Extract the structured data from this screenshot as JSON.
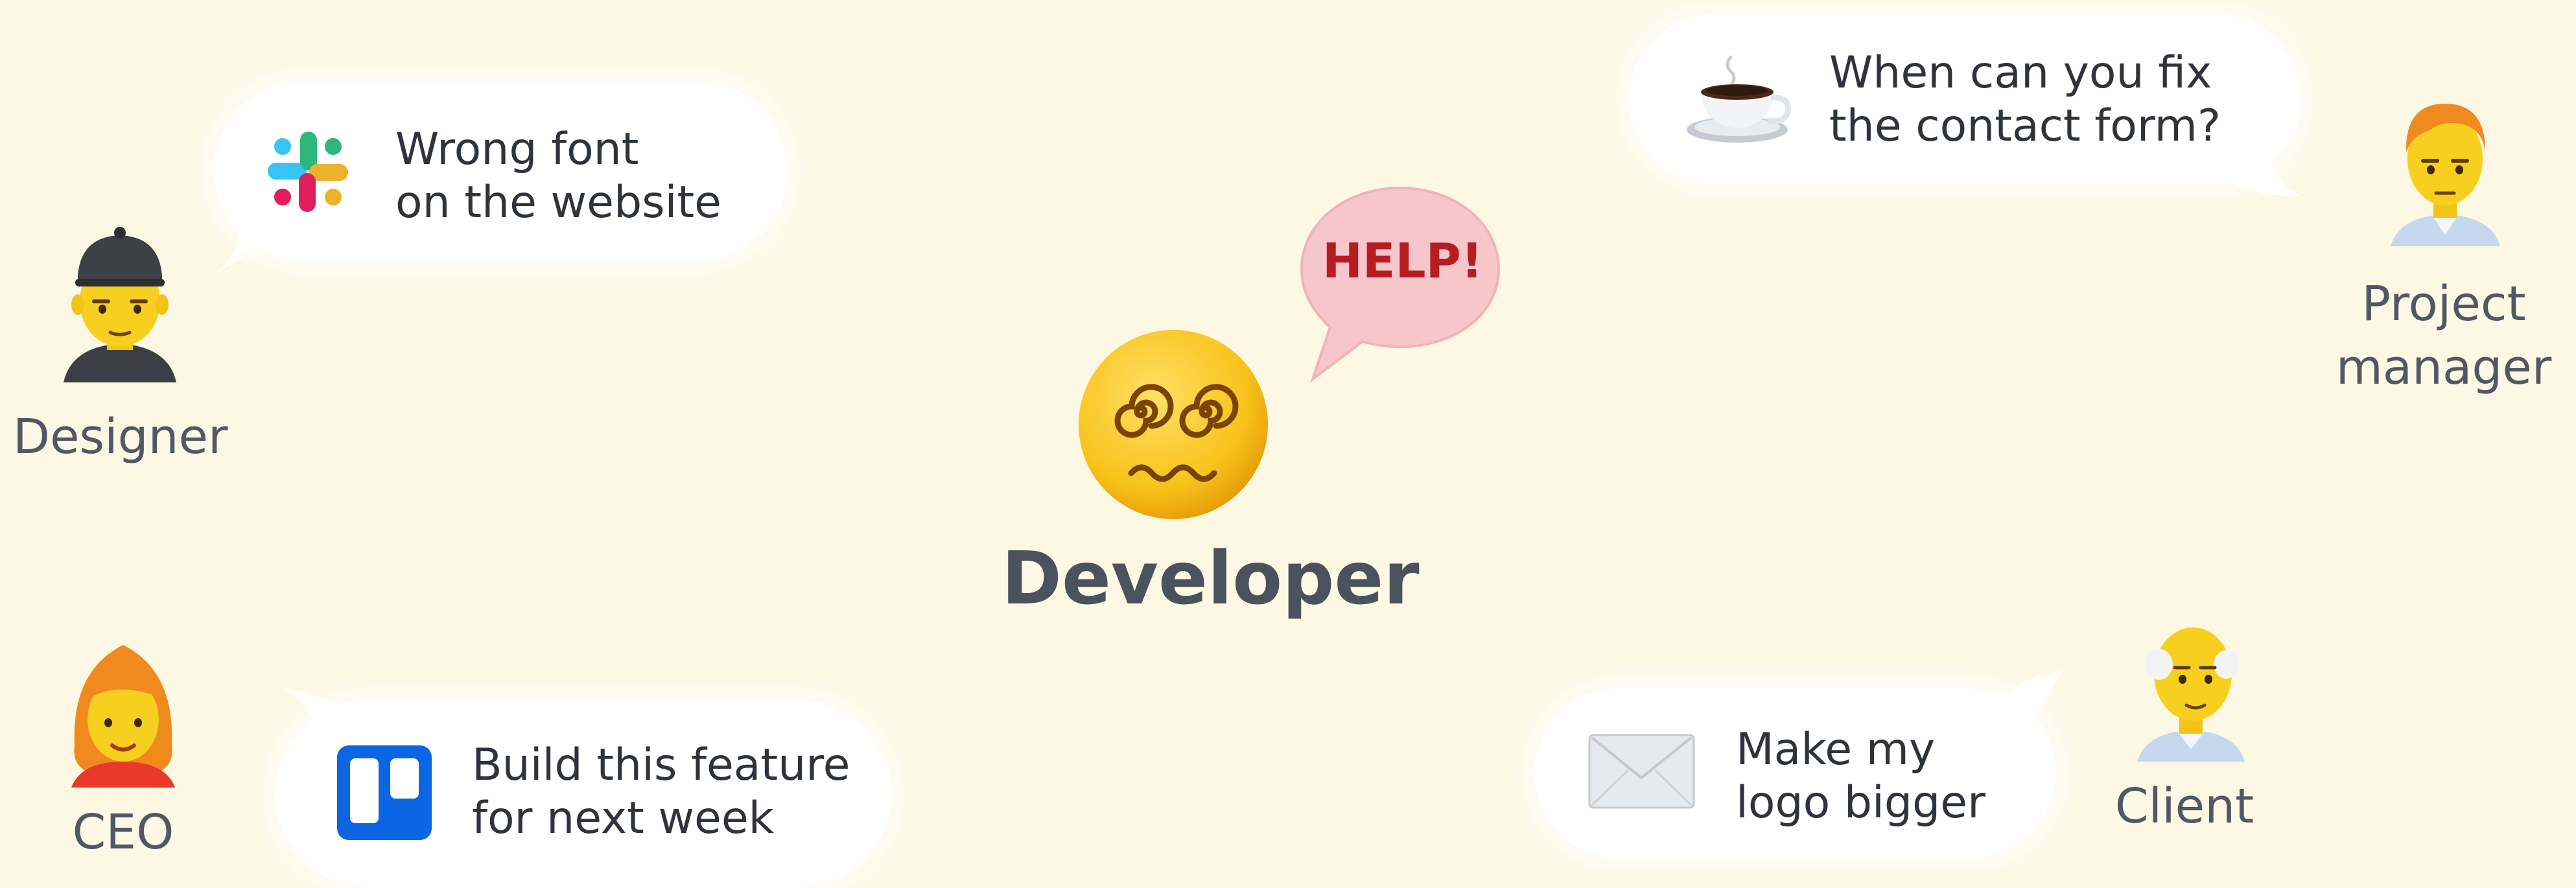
{
  "center": {
    "label": "Developer",
    "face_icon": "dizzy-face-icon",
    "help_bubble_text": "HELP!"
  },
  "people": {
    "designer": "Designer",
    "ceo": "CEO",
    "project_manager": [
      "Project",
      "manager"
    ],
    "client": "Client"
  },
  "messages": {
    "designer": {
      "lines": [
        "Wrong font",
        "on the website"
      ],
      "icon": "slack-icon"
    },
    "project_manager": {
      "lines": [
        "When can you fix",
        "the contact form?"
      ],
      "icon": "coffee-icon"
    },
    "ceo": {
      "lines": [
        "Build this feature",
        "for next week"
      ],
      "icon": "trello-icon"
    },
    "client": {
      "lines": [
        "Make my",
        "logo bigger"
      ],
      "icon": "envelope-icon"
    }
  },
  "colors": {
    "background": "#fdf8e4",
    "bubble": "#ffffff",
    "text": "#2e333d",
    "help_bubble": "#f7c6cb",
    "help_text": "#b81c23",
    "emoji_yellow": "#f5c518",
    "trello_blue": "#0c66e4"
  }
}
